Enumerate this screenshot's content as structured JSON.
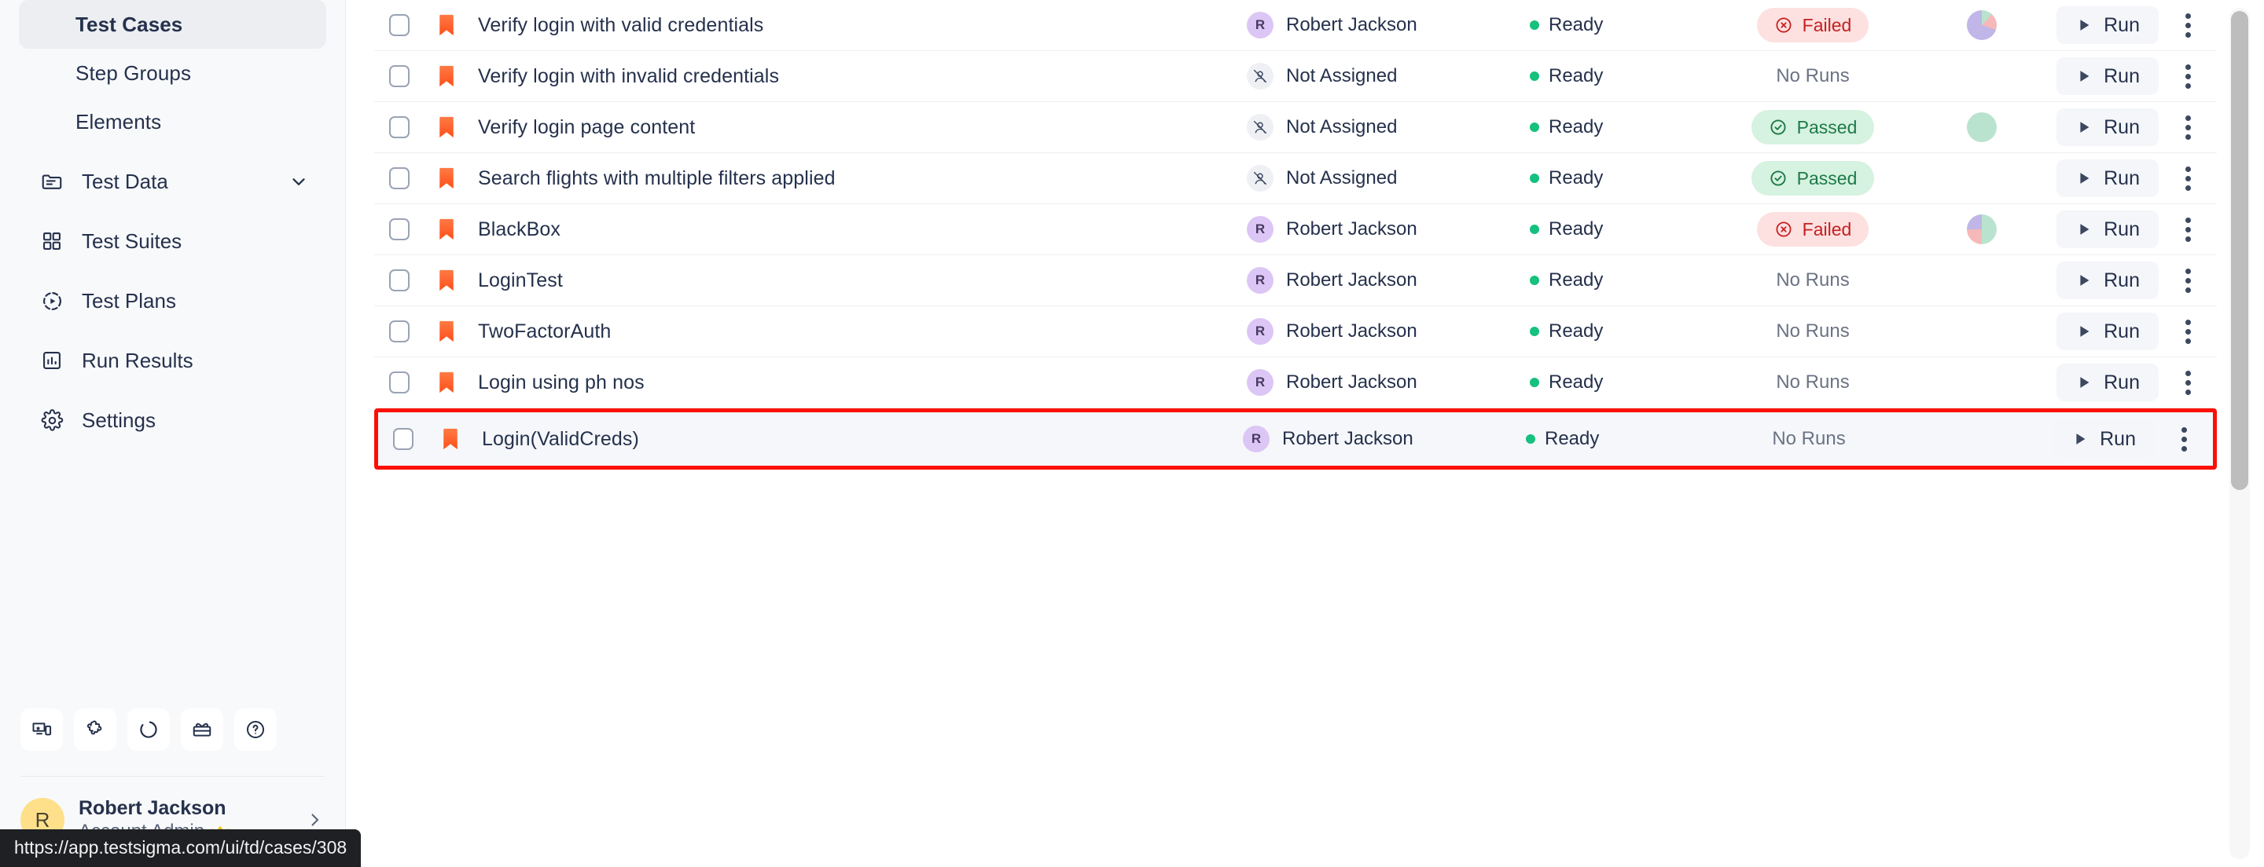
{
  "sidebar": {
    "sub_items": [
      {
        "label": "Test Cases",
        "active": true
      },
      {
        "label": "Step Groups",
        "active": false
      },
      {
        "label": "Elements",
        "active": false
      }
    ],
    "nav_items": [
      {
        "label": "Test Data",
        "icon": "folder-list-icon",
        "has_chevron": true
      },
      {
        "label": "Test Suites",
        "icon": "grid-icon",
        "has_chevron": false
      },
      {
        "label": "Test Plans",
        "icon": "play-circle-icon",
        "has_chevron": false
      },
      {
        "label": "Run Results",
        "icon": "bar-chart-icon",
        "has_chevron": false
      },
      {
        "label": "Settings",
        "icon": "gear-icon",
        "has_chevron": false
      }
    ],
    "tools": [
      {
        "name": "device-lab-icon"
      },
      {
        "name": "puzzle-extension-icon"
      },
      {
        "name": "progress-circle-icon"
      },
      {
        "name": "gift-icon"
      },
      {
        "name": "help-question-icon"
      }
    ],
    "user": {
      "avatar_initial": "R",
      "name": "Robert Jackson",
      "role": "Account Admin",
      "crown": "♛"
    }
  },
  "statusbar": {
    "url": "https://app.testsigma.com/ui/td/cases/308"
  },
  "table": {
    "run_label": "Run",
    "not_assigned_label": "Not Assigned",
    "no_runs_label": "No Runs",
    "rows": [
      {
        "name": "Verify login with valid credentials",
        "assignee": "Robert Jackson",
        "assignee_initial": "R",
        "assigned": true,
        "status": "Ready",
        "result": "Failed",
        "result_type": "failed",
        "chart": {
          "purple": 70,
          "pink": 18,
          "green": 12
        },
        "highlight": false
      },
      {
        "name": "Verify login with invalid credentials",
        "assignee": "Not Assigned",
        "assignee_initial": "",
        "assigned": false,
        "status": "Ready",
        "result": "No Runs",
        "result_type": "none",
        "chart": null,
        "highlight": false
      },
      {
        "name": "Verify login page content",
        "assignee": "Not Assigned",
        "assignee_initial": "",
        "assigned": false,
        "status": "Ready",
        "result": "Passed",
        "result_type": "passed",
        "chart": {
          "purple": 0,
          "pink": 0,
          "green": 100
        },
        "highlight": false
      },
      {
        "name": "Search flights with multiple filters applied",
        "assignee": "Not Assigned",
        "assignee_initial": "",
        "assigned": false,
        "status": "Ready",
        "result": "Passed",
        "result_type": "passed",
        "chart": null,
        "highlight": false
      },
      {
        "name": "BlackBox",
        "assignee": "Robert Jackson",
        "assignee_initial": "R",
        "assigned": true,
        "status": "Ready",
        "result": "Failed",
        "result_type": "failed",
        "chart": {
          "green": 50,
          "purple": 25,
          "pink": 25
        },
        "highlight": false
      },
      {
        "name": "LoginTest",
        "assignee": "Robert Jackson",
        "assignee_initial": "R",
        "assigned": true,
        "status": "Ready",
        "result": "No Runs",
        "result_type": "none",
        "chart": null,
        "highlight": false
      },
      {
        "name": "TwoFactorAuth",
        "assignee": "Robert Jackson",
        "assignee_initial": "R",
        "assigned": true,
        "status": "Ready",
        "result": "No Runs",
        "result_type": "none",
        "chart": null,
        "highlight": false
      },
      {
        "name": "Login using ph nos",
        "assignee": "Robert Jackson",
        "assignee_initial": "R",
        "assigned": true,
        "status": "Ready",
        "result": "No Runs",
        "result_type": "none",
        "chart": null,
        "highlight": false
      },
      {
        "name": "Login(ValidCreds)",
        "assignee": "Robert Jackson",
        "assignee_initial": "R",
        "assigned": true,
        "status": "Ready",
        "result": "No Runs",
        "result_type": "none",
        "chart": null,
        "highlight": true
      }
    ]
  },
  "colors": {
    "accent_flag": "#ff6b3d",
    "highlight_border": "#fb1008",
    "ready_dot": "#16c07e",
    "failed_text": "#c62020",
    "failed_bg": "#fde0e0",
    "passed_text": "#1e7a48",
    "passed_bg": "#d6f2e0",
    "avatar_purple": "#dcc6f5",
    "user_avatar_yellow": "#ffe08a",
    "chart_purple": "#c0b6e8",
    "chart_green": "#b9e3ce",
    "chart_pink": "#f6b8b8",
    "text_primary": "#25314c"
  }
}
